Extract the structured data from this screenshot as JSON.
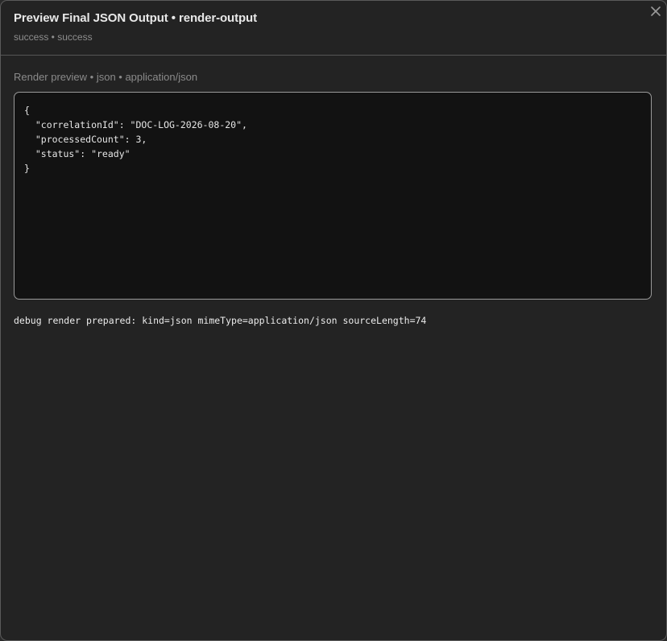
{
  "dialog": {
    "title": "Preview Final JSON Output • render-output",
    "subtitle": "success • success",
    "close_icon": "close-icon"
  },
  "preview": {
    "label": "Render preview • json • application/json",
    "code": "{\n  \"correlationId\": \"DOC-LOG-2026-08-20\",\n  \"processedCount\": 3,\n  \"status\": \"ready\"\n}"
  },
  "debug": {
    "message": "debug render prepared: kind=json mimeType=application/json sourceLength=74"
  },
  "colors": {
    "background": "#232323",
    "code_background": "#121212",
    "border": "#9a9a9a",
    "title": "#e8e8e8",
    "muted": "#8e8e8e"
  }
}
